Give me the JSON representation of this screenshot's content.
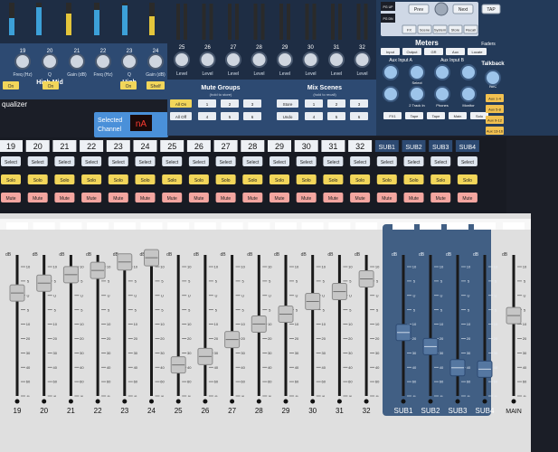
{
  "top": {
    "eq_labels": [
      "High Mid",
      "High"
    ],
    "eq_knob_labels": [
      "Freq (Hz)",
      "Q",
      "Gain (dB)",
      "Freq (Hz)",
      "Q",
      "Gain (dB)"
    ],
    "eq_knob_numbers": [
      "19",
      "20",
      "21",
      "22",
      "23",
      "24"
    ],
    "on_label": "On",
    "shelf_label": "Shelf",
    "equalizer_label": "qualizer",
    "selected_channel_label": "Selected Channel",
    "selected_channel_display": "nA",
    "level_label": "Level",
    "level_numbers": [
      "25",
      "26",
      "27",
      "28",
      "29",
      "30",
      "31",
      "32"
    ],
    "mute_groups_title": "Mute Groups",
    "mute_groups_sub": "(hold to store)",
    "mix_scenes_title": "Mix Scenes",
    "mix_scenes_sub": "(hold to recall)",
    "mute_group_buttons": [
      "All On",
      "All Off",
      "1",
      "2",
      "3",
      "4",
      "5",
      "6"
    ],
    "mix_scene_buttons": [
      "Store",
      "Undo",
      "1",
      "2",
      "3",
      "4",
      "5",
      "6"
    ],
    "nav_buttons": [
      "Prev",
      "Next",
      "TAP"
    ],
    "nav_row": [
      "FX",
      "Scene",
      "System",
      "Store",
      "Recall"
    ],
    "pg_labels": [
      "PG UP",
      "PG DN"
    ],
    "meters_title": "Meters",
    "meters_buttons": [
      "Input",
      "Output",
      "GR",
      "Aux",
      "Locate"
    ],
    "faders_label": "Faders",
    "aux_input_a": "Aux Input A",
    "aux_input_b": "Aux Input B",
    "talkback": "Talkback",
    "mic": "Mic",
    "monitor_labels": [
      "Select",
      "2 Track In",
      "Phones",
      "Monitor",
      "FX1",
      "Tape",
      "Tape",
      "Main",
      "Solo"
    ],
    "right_column": [
      "Aux 1-4",
      "Aux 5-8",
      "Aux 9-12",
      "Aux 13-16",
      "Main",
      "Talk",
      "GEQ"
    ]
  },
  "strip": {
    "channel_numbers": [
      "19",
      "20",
      "21",
      "22",
      "23",
      "24",
      "25",
      "26",
      "27",
      "28",
      "29",
      "30",
      "31",
      "32"
    ],
    "sub_numbers": [
      "SUB1",
      "SUB2",
      "SUB3",
      "SUB4"
    ],
    "select_label": "Select",
    "solo_label": "Solo",
    "mute_label": "Mute"
  },
  "faders": {
    "db_label": "dB",
    "scale_marks": [
      "10",
      "5",
      "U",
      "5",
      "10",
      "20",
      "30",
      "40",
      "60",
      "∞"
    ],
    "channel_labels": [
      "19",
      "20",
      "21",
      "22",
      "23",
      "24",
      "25",
      "26",
      "27",
      "28",
      "29",
      "30",
      "31",
      "32"
    ],
    "sub_labels": [
      "SUB1",
      "SUB2",
      "SUB3",
      "SUB4"
    ],
    "main_label": "MAIN",
    "channel_levels": [
      0.73,
      0.8,
      0.86,
      0.89,
      0.95,
      0.98,
      0.22,
      0.28,
      0.4,
      0.51,
      0.58,
      0.67,
      0.74,
      0.83
    ],
    "sub_levels": [
      0.45,
      0.35,
      0.2,
      0.19
    ],
    "main_level": 0.57
  },
  "colors": {
    "panel_dark": "#1b1e27",
    "panel_blue": "#2d4a72",
    "sub_panel": "#415f84",
    "fader_bed": "#ececec",
    "accent_red": "#e0393e",
    "solo_yellow": "#f2d65a",
    "mute_pink": "#f4a6a0"
  }
}
